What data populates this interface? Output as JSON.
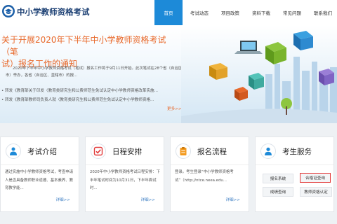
{
  "header": {
    "title": "中小学教师资格考试",
    "nav": [
      "首页",
      "考试动态",
      "项目政策",
      "资料下载",
      "常见问题",
      "联系我们"
    ]
  },
  "banner": {
    "headline_line1": "关于开展2020年下半年中小学教师资格考试（笔",
    "headline_line2": "试）报名工作的通知",
    "summary": "2020年下半年中小学教师资格考试（笔试）报名工作将于9月11日开始。此次笔试在28个省（自治区、直辖市）举办，各省（自治区、直辖市）的报...",
    "bullets": [
      "• 转发《教育部关于印发〈教育类研究生和公费师范生免试认定中小学教师资格改革实施...",
      "• 转发《教育部教师司负责人就〈教育类研究生和公费师范生免试认定中小学教师资格..."
    ],
    "more": "更多>>"
  },
  "cards": [
    {
      "title": "考试介绍",
      "body": "通过实施中小学教师资格考试，考查申请人是否具备教师职业道德、基本素养、教育教学能...",
      "more": "详细>>",
      "icon": "person-icon",
      "color": "#1d8ad8"
    },
    {
      "title": "日程安排",
      "body": "2020年中小学教师资格考试日程安排：下半年笔试时间为10月31日，下半年面试时...",
      "more": "详细>>",
      "icon": "check-icon",
      "color": "#e23a3a"
    },
    {
      "title": "报名流程",
      "body": "登录。考生登录“中小学教师资格考试”（http://ntce.neea.edu...",
      "more": "详细>>",
      "icon": "clipboard-icon",
      "color": "#f39a1e"
    },
    {
      "title": "考生服务",
      "buttons": [
        "报名系统",
        "合格证查询",
        "成绩查询",
        "教师资格认定"
      ],
      "icon": "user-service-icon",
      "color": "#1d8ad8"
    }
  ]
}
